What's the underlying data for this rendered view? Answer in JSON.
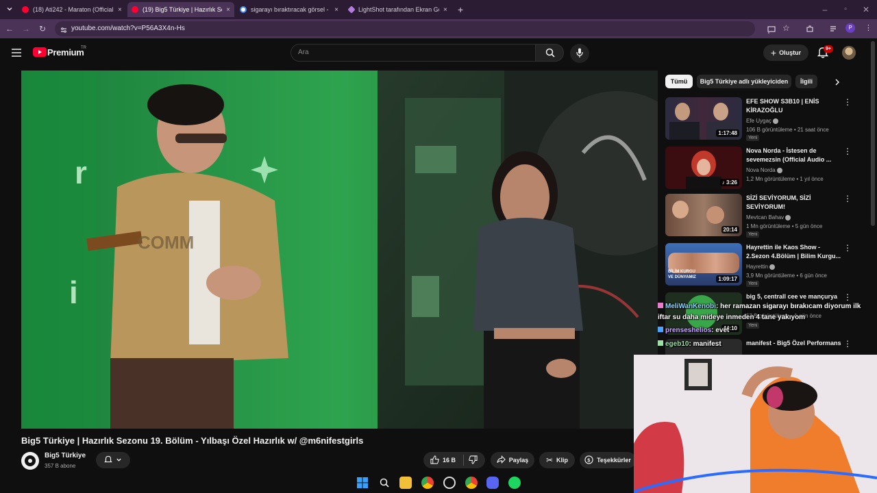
{
  "browser": {
    "tabs": [
      {
        "title": "(18) Ati242 - Maraton (Official V",
        "icon": "youtube-favicon",
        "active": false
      },
      {
        "title": "(19) Big5 Türkiye | Hazırlık Sezo",
        "icon": "youtube-favicon",
        "active": true
      },
      {
        "title": "sigarayı bıraktıracak görsel - Go",
        "icon": "google-favicon",
        "active": false
      },
      {
        "title": "LightShot tarafından Ekran Görü",
        "icon": "lightshot-favicon",
        "active": false
      }
    ],
    "close_glyph": "×",
    "new_tab_glyph": "+",
    "url": "youtube.com/watch?v=P56A3X4n-Hs",
    "profile_initial": "P"
  },
  "youtube": {
    "logo_text": "Premium",
    "logo_badge": "TR",
    "search_placeholder": "Ara",
    "create_label": "Oluştur",
    "notifications_badge": "9+"
  },
  "video": {
    "title": "Big5 Türkiye | Hazırlık Sezonu 19. Bölüm - Yılbaşı Özel Hazırlık w/ @m6nifestgirls",
    "channel": "Big5 Türkiye",
    "subscribers": "357 B abone",
    "likes": "16 B",
    "share_label": "Paylaş",
    "clip_label": "Klip",
    "thanks_label": "Teşekkürler"
  },
  "chips": [
    {
      "label": "Tümü",
      "active": true
    },
    {
      "label": "Big5 Türkiye adlı yükleyiciden",
      "active": false
    },
    {
      "label": "İlgili",
      "active": false
    }
  ],
  "recommendations": [
    {
      "title": "EFE SHOW S3B10 | ENİS KİRAZOĞLU",
      "channel": "Efe Uygaç",
      "meta": "106 B görüntüleme • 21 saat önce",
      "duration": "1:17:48",
      "badge": "Yeni",
      "verified": true
    },
    {
      "title": "Nova Norda - İstesen de sevemezsin (Official Audio ...",
      "channel": "Nova Norda",
      "meta": "1,2 Mn görüntüleme • 1 yıl önce",
      "duration": "3:26",
      "badge": "",
      "verified": true
    },
    {
      "title": "SİZİ SEVİYORUM, SİZİ SEVİYORUM!",
      "channel": "Mevtcan Bahav",
      "meta": "1 Mn görüntüleme • 5 gün önce",
      "duration": "20:14",
      "badge": "Yeni",
      "verified": true
    },
    {
      "title": "Hayrettin ile Kaos Show - 2.Sezon 4.Bölüm | Bilim Kurgu...",
      "channel": "Hayrettin",
      "meta": "3,9 Mn görüntüleme • 6 gün önce",
      "duration": "1:09:17",
      "badge": "Yeni",
      "verified": true
    },
    {
      "title": "big 5, centrall cee ve mançurya",
      "channel": "",
      "meta": "57 B görüntüleme • 1 gün önce",
      "duration": "44:10",
      "badge": "Yeni",
      "verified": false
    },
    {
      "title": "manifest - Big5 Özel Performans",
      "channel": "",
      "meta": "",
      "duration": "",
      "badge": "",
      "verified": false
    }
  ],
  "chat": [
    {
      "user": "MeliWanKenobi",
      "text": ": her ramazan sigarayı bırakıcam diyorum ilk"
    },
    {
      "user": "",
      "text": "iftar su daha mideye inmeden 4 tane yakıyom"
    },
    {
      "user": "prenseshelios",
      "text": ": evet"
    },
    {
      "user": "egeb10",
      "text": ": manifest"
    }
  ],
  "colors": {
    "background": "#0f0f0f",
    "youtube_red": "#ff0033",
    "chrome_frame": "#2b1b33",
    "chrome_toolbar": "#4a3356",
    "pill": "#272727"
  }
}
